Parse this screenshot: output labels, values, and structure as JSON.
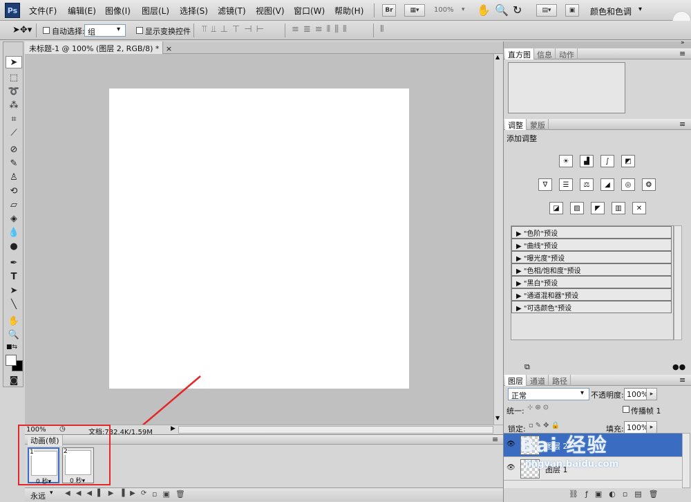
{
  "app": {
    "logo": "Ps"
  },
  "menubar": {
    "items": [
      "文件(F)",
      "编辑(E)",
      "图像(I)",
      "图层(L)",
      "选择(S)",
      "滤镜(T)",
      "视图(V)",
      "窗口(W)",
      "帮助(H)"
    ],
    "bridge_label": "Br",
    "zoom_value": "100%",
    "workspace": "颜色和色调"
  },
  "optbar": {
    "auto_select_label": "自动选择:",
    "auto_select_value": "组",
    "show_transform_label": "显示变换控件"
  },
  "document": {
    "tab_title": "未标题-1 @ 100% (图层 2, RGB/8) *",
    "status_zoom": "100%",
    "status_doc": "文档:732.4K/1.59M"
  },
  "animation": {
    "title": "动画(帧)",
    "frames": [
      {
        "num": "1",
        "time": "0 秒▾"
      },
      {
        "num": "2",
        "time": "0 秒▾"
      }
    ],
    "loop": "永远"
  },
  "histogram_panel": {
    "tabs": [
      "直方图",
      "信息",
      "动作"
    ]
  },
  "adjust_panel": {
    "tabs": [
      "调整",
      "蒙版"
    ],
    "heading": "添加调整",
    "presets": [
      "\"色阶\"预设",
      "\"曲线\"预设",
      "\"曝光度\"预设",
      "\"色相/饱和度\"预设",
      "\"黑白\"预设",
      "\"通道混和器\"预设",
      "\"可选颜色\"预设"
    ]
  },
  "layers_panel": {
    "tabs": [
      "图层",
      "通道",
      "路径"
    ],
    "blend_mode": "正常",
    "opacity_label": "不透明度:",
    "opacity_value": "100%",
    "unify_label": "统一:",
    "propagate_label": "传播帧 1",
    "lock_label": "锁定:",
    "fill_label": "填充:",
    "fill_value": "100%",
    "layers": [
      {
        "name": "图层 2",
        "selected": true
      },
      {
        "name": "图层 1",
        "selected": false
      }
    ]
  },
  "watermark": {
    "main": "Bai 经验",
    "sub": "jingyan.baidu.com"
  },
  "colors": {
    "accent": "#3a6cc2",
    "annotation_red": "#e32626"
  }
}
